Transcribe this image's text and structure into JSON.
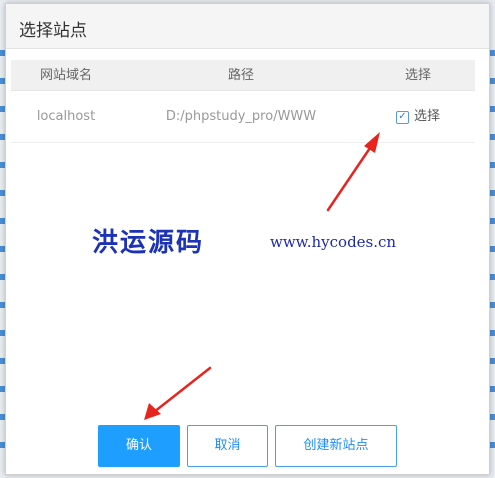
{
  "dialog": {
    "title": "选择站点"
  },
  "table": {
    "headers": [
      "网站域名",
      "路径",
      "选择"
    ],
    "rows": [
      {
        "domain": "localhost",
        "path": "D:/phpstudy_pro/WWW",
        "checked": true,
        "select_label": "选择"
      }
    ]
  },
  "watermark": {
    "text": "洪运源码",
    "url": "www.hycodes.cn"
  },
  "buttons": {
    "confirm": "确认",
    "cancel": "取消",
    "create": "创建新站点"
  },
  "icons": {
    "checkbox": "checkbox-checked-icon",
    "arrows": "red-arrow-icon"
  },
  "colors": {
    "primary": "#1e9fff",
    "watermark": "#1c33b5",
    "arrow": "#e8241e"
  }
}
